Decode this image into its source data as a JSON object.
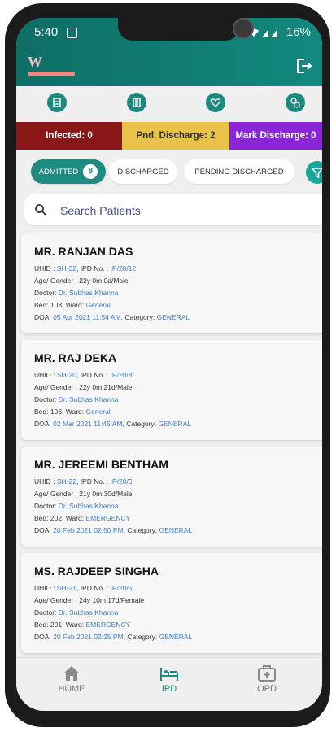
{
  "status_bar": {
    "time": "5:40",
    "battery": "16%"
  },
  "logo": {
    "letter": "W"
  },
  "stats": {
    "infected": "Infected: 0",
    "pnd_discharge": "Pnd. Discharge: 2",
    "mark_discharge": "Mark Discharge: 0"
  },
  "tabs": {
    "admitted": "ADMITTED",
    "admitted_count": "8",
    "discharged": "DISCHARGED",
    "pending": "PENDING DISCHARGED"
  },
  "search": {
    "placeholder": "Search Patients"
  },
  "patients": [
    {
      "name": "MR. RANJAN DAS",
      "uhid": "SH-32",
      "ipd": "IP/20/12",
      "age_gender": "22y 0m 0d/Male",
      "doctor": "Dr. Subhas Khanna",
      "bed": "103",
      "ward": "General",
      "doa": "05 Apr 2021 11:54 AM",
      "category": "GENERAL"
    },
    {
      "name": "MR. RAJ DEKA",
      "uhid": "SH-20",
      "ipd": "IP/20/8",
      "age_gender": "22y 0m 21d/Male",
      "doctor": "Dr. Subhas Khanna",
      "bed": "106",
      "ward": "General",
      "doa": "02 Mar 2021 11:45 AM",
      "category": "GENERAL"
    },
    {
      "name": "MR. JEREEMI BENTHAM",
      "uhid": "SH-22",
      "ipd": "IP/20/6",
      "age_gender": "21y 0m 30d/Male",
      "doctor": "Dr. Subhas Khanna",
      "bed": "202",
      "ward": "EMERGENCY",
      "doa": "20 Feb 2021 02:50 PM",
      "category": "GENERAL"
    },
    {
      "name": "MS. RAJDEEP SINGHA",
      "uhid": "SH-21",
      "ipd": "IP/20/5",
      "age_gender": "24y 10m 17d/Female",
      "doctor": "Dr. Subhas Khanna",
      "bed": "201",
      "ward": "EMERGENCY",
      "doa": "20 Feb 2021 02:25 PM",
      "category": "GENERAL"
    }
  ],
  "labels": {
    "uhid": "UHID : ",
    "ipd": ", IPD No. : ",
    "age": "Age/ Gender : ",
    "doctor": "Doctor: ",
    "bed": "Bed: ",
    "ward": ", Ward: ",
    "doa": "DOA: ",
    "category": ", Category: "
  },
  "nav": {
    "home": "HOME",
    "ipd": "IPD",
    "opd": "OPD"
  },
  "colors": {
    "primary": "#1f8a7f",
    "infected": "#8a1717",
    "pending": "#e9c24a",
    "mark": "#8b26d8",
    "link": "#3b7fd1"
  }
}
